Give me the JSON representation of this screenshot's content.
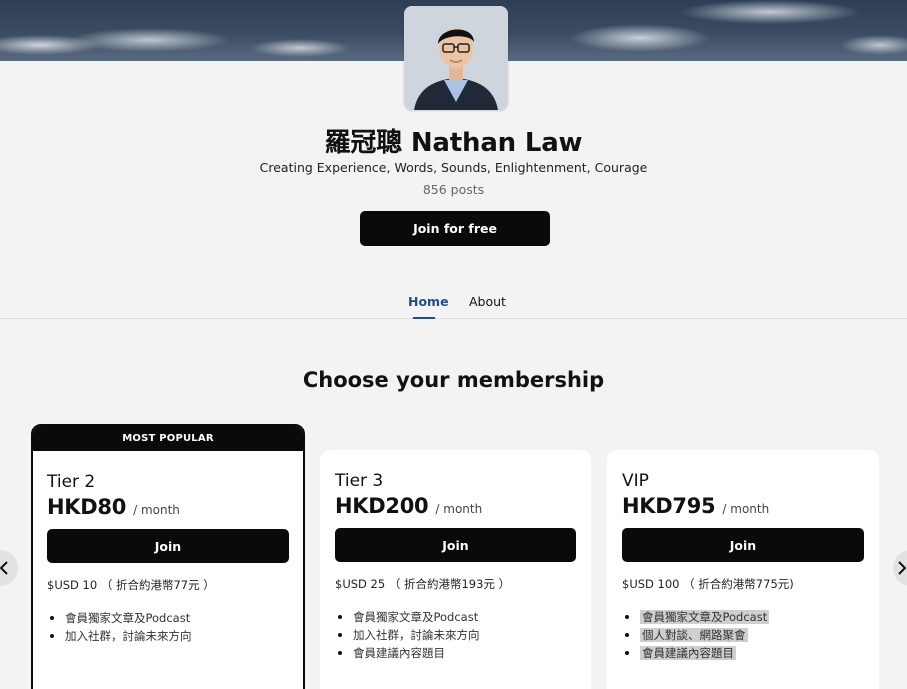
{
  "creator": {
    "name": "羅冠聰 Nathan Law",
    "tagline": "Creating Experience, Words, Sounds, Enlightenment, Courage",
    "post_count": "856 posts",
    "join_label": "Join for free"
  },
  "tabs": [
    {
      "label": "Home",
      "active": true
    },
    {
      "label": "About",
      "active": false
    }
  ],
  "membership": {
    "title": "Choose your membership",
    "tiers": [
      {
        "badge": "MOST POPULAR",
        "name": "Tier 2",
        "price": "HKD80",
        "period": "/ month",
        "join_label": "Join",
        "usd_note": "$USD 10 （ 折合約港幣77元 ）",
        "benefits": [
          "會員獨家文章及Podcast",
          "加入社群，討論未來方向"
        ]
      },
      {
        "name": "Tier 3",
        "price": "HKD200",
        "period": "/ month",
        "join_label": "Join",
        "usd_note": "$USD 25 （ 折合約港幣193元 ）",
        "benefits": [
          "會員獨家文章及Podcast",
          "加入社群，討論未來方向",
          "會員建議內容題目"
        ]
      },
      {
        "name": "VIP",
        "price": "HKD795",
        "period": "/ month",
        "join_label": "Join",
        "usd_note": "$USD 100 （ 折合約港幣775元)",
        "benefits": [
          "會員獨家文章及Podcast",
          "個人對談、網路聚會",
          "會員建議內容題目"
        ]
      }
    ]
  },
  "colors": {
    "accent": "#1d4f8f",
    "button": "#0a0a0a",
    "background": "#f3f3f3"
  },
  "icons": {
    "carousel_prev": "chevron-left-icon",
    "carousel_next": "chevron-right-icon"
  }
}
